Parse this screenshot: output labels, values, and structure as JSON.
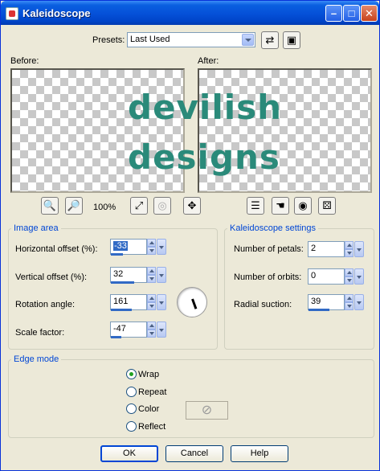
{
  "window": {
    "title": "Kaleidoscope"
  },
  "presets": {
    "label": "Presets:",
    "value": "Last Used"
  },
  "preview": {
    "before_label": "Before:",
    "after_label": "After:",
    "watermark_line1": "devilish",
    "watermark_line2": "designs"
  },
  "zoom": {
    "percent": "100%"
  },
  "image_area": {
    "legend": "Image area",
    "horizontal_offset": {
      "label": "Horizontal offset (%):",
      "value": "-33",
      "level": 0.33
    },
    "vertical_offset": {
      "label": "Vertical offset (%):",
      "value": "32",
      "level": 0.66
    },
    "rotation_angle": {
      "label": "Rotation angle:",
      "value": "161",
      "level": 0.6
    },
    "scale_factor": {
      "label": "Scale factor:",
      "value": "-47",
      "level": 0.3
    }
  },
  "kaleidoscope": {
    "legend": "Kaleidoscope settings",
    "petals": {
      "label": "Number of petals:",
      "value": "2",
      "level": 0.0
    },
    "orbits": {
      "label": "Number of orbits:",
      "value": "0",
      "level": 0.0
    },
    "suction": {
      "label": "Radial suction:",
      "value": "39",
      "level": 0.58
    }
  },
  "edge_mode": {
    "legend": "Edge mode",
    "options": [
      "Wrap",
      "Repeat",
      "Color",
      "Reflect"
    ],
    "selected": "Wrap"
  },
  "buttons": {
    "ok": "OK",
    "cancel": "Cancel",
    "help": "Help"
  },
  "icons": [
    "zoom-out-icon",
    "zoom-in-icon",
    "fit-icon",
    "reset-zoom-icon",
    "pan-icon",
    "list-icon",
    "proof-icon",
    "eye-icon",
    "randomize-icon",
    "save-preset-icon",
    "revert-icon"
  ]
}
